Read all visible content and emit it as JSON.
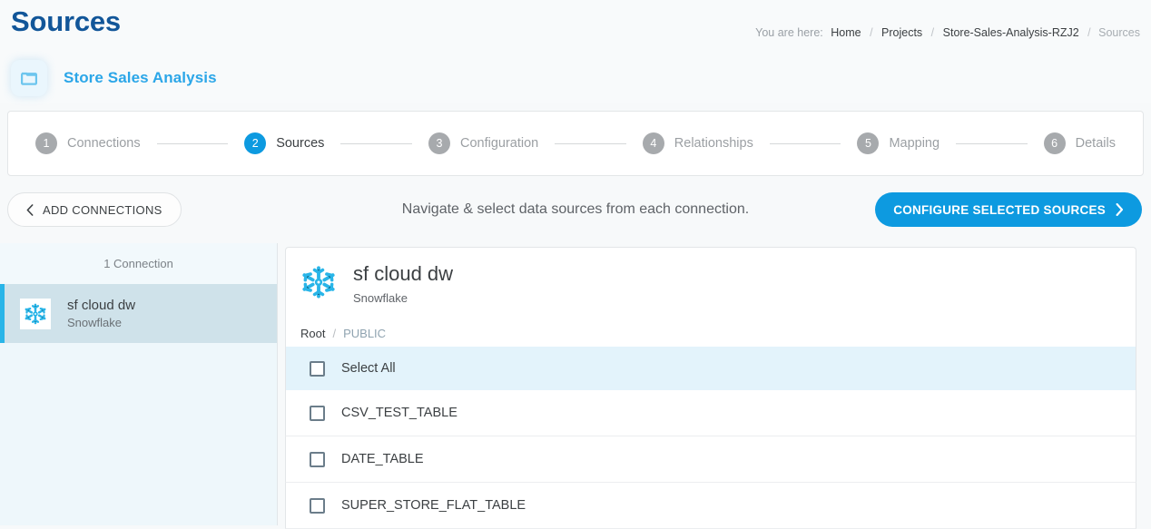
{
  "header": {
    "title": "Sources",
    "breadcrumb": {
      "label": "You are here:",
      "items": [
        "Home",
        "Projects",
        "Store-Sales-Analysis-RZJ2",
        "Sources"
      ],
      "separator": "/"
    },
    "project": {
      "name": "Store Sales Analysis",
      "icon": "folder-icon"
    }
  },
  "stepper": {
    "steps": [
      {
        "number": "1",
        "label": "Connections",
        "active": false
      },
      {
        "number": "2",
        "label": "Sources",
        "active": true
      },
      {
        "number": "3",
        "label": "Configuration",
        "active": false
      },
      {
        "number": "4",
        "label": "Relationships",
        "active": false
      },
      {
        "number": "5",
        "label": "Mapping",
        "active": false
      },
      {
        "number": "6",
        "label": "Details",
        "active": false
      }
    ]
  },
  "action_bar": {
    "back_label": "ADD CONNECTIONS",
    "back_icon": "chevron-left-icon",
    "hint": "Navigate & select data sources from each connection.",
    "cta_label": "CONFIGURE SELECTED SOURCES",
    "cta_icon": "chevron-right-icon"
  },
  "sidebar": {
    "count_label": "1 Connection",
    "connections": [
      {
        "name": "sf cloud dw",
        "type": "Snowflake",
        "icon": "snowflake-icon",
        "selected": true
      }
    ]
  },
  "source_panel": {
    "title": "sf cloud dw",
    "subtitle": "Snowflake",
    "icon": "snowflake-icon",
    "path": {
      "root": "Root",
      "separator": "/",
      "current": "PUBLIC"
    },
    "select_all_label": "Select All",
    "tables": [
      {
        "name": "CSV_TEST_TABLE",
        "checked": false
      },
      {
        "name": "DATE_TABLE",
        "checked": false
      },
      {
        "name": "SUPER_STORE_FLAT_TABLE",
        "checked": false
      }
    ]
  },
  "colors": {
    "brand_blue": "#0d9ae0",
    "snowflake_cyan": "#29b5e8",
    "title_blue": "#125699",
    "page_bg": "#f7f9fa",
    "selected_row_bg": "#cfe2ea",
    "select_all_bg": "#e3f3fb"
  }
}
